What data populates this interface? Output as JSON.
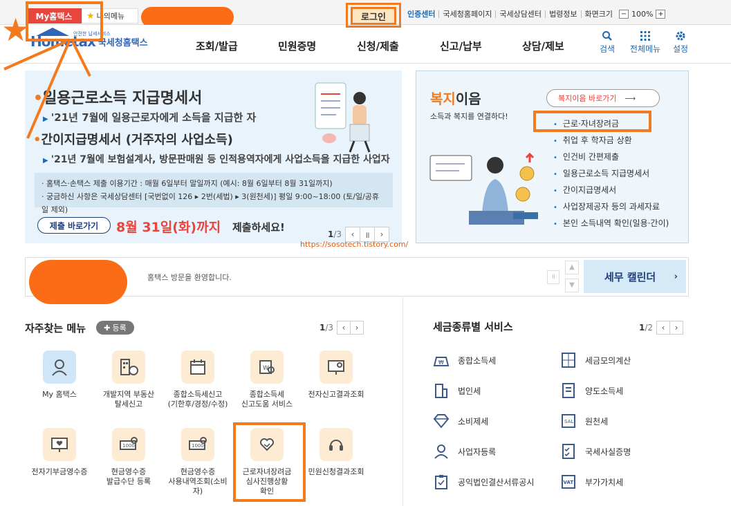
{
  "topbar": {
    "my_tab": "My홈택스",
    "fav_tab": "나의메뉴",
    "login": "로그인",
    "links": [
      "인증센터",
      "국세청홈페이지",
      "국세상담센터",
      "법령정보",
      "화면크기"
    ],
    "zoom_minus": "−",
    "zoom_value": "100%",
    "zoom_plus": "+"
  },
  "header": {
    "logo_en": "Hometax",
    "logo_ko": "국세청홈택스",
    "logo_sub": "안전한 납세서비스",
    "nav": [
      "조회/발급",
      "민원증명",
      "신청/제출",
      "신고/납부",
      "상담/제보"
    ],
    "tools": [
      {
        "label": "검색",
        "icon": "search-icon"
      },
      {
        "label": "전체메뉴",
        "icon": "grid-menu-icon"
      },
      {
        "label": "설정",
        "icon": "gear-icon"
      }
    ]
  },
  "banner": {
    "heading1": "일용근로소득 지급명세서",
    "text1": "'21년 7월에 일용근로자에게 소득을 지급한 자",
    "heading2": "간이지급명세서 (거주자의 사업소득)",
    "text2": "'21년 7월에 보험설계사, 방문판매원 등 인적용역자에게 사업소득을 지급한 사업자",
    "notice_line1": "· 홈택스·손택스 제출 이용기간 : 매월 6일부터 말일까지 (예시: 8월 6일부터 8월 31일까지)",
    "notice_line2": "· 궁금하신 사항은 국세상담센터 [국번없이 126 ▸ 2번(세법) ▸ 3(원천세)] 평일 9:00~18:00 (토/일/공휴일 제외)",
    "go_button": "제출 바로가기",
    "deadline": "8월 31일(화)까지",
    "deadline_suffix": "제출하세요!",
    "page_current": "1",
    "page_total": "/3"
  },
  "watermark_url": "https://sosotech.tistory.com/",
  "welfare": {
    "title_accent": "복지",
    "title_rest": "이음",
    "subtitle": "소득과 복지를 연결하다!",
    "go_button": "복지이음 바로가기",
    "items": [
      "근로·자녀장려금",
      "취업 후 학자금 상환",
      "인건비 간편제출",
      "일용근로소득 지급명세서",
      "간이지급명세서",
      "사업장제공자 등의 과세자료",
      "본인 소득내역 확인(일용·간이)"
    ]
  },
  "notice_bar": {
    "message": "홈택스 방문을 환영합니다.",
    "calendar_button": "세무 캘린더"
  },
  "frequent": {
    "title": "자주찾는 메뉴",
    "register": "등록",
    "page_current": "1",
    "page_total": "/3",
    "items": [
      {
        "label": "My 홈택스",
        "icon": "person-icon"
      },
      {
        "label": "개발지역 부동산\n탈세신고",
        "icon": "building-money-icon"
      },
      {
        "label": "종합소득세신고\n(기한후/경정/수정)",
        "icon": "calendar-icon"
      },
      {
        "label": "종합소득세\n신고도움 서비스",
        "icon": "document-search-icon"
      },
      {
        "label": "전자신고결과조회",
        "icon": "monitor-search-icon"
      },
      {
        "label": "전자기부금영수증",
        "icon": "monitor-heart-icon"
      },
      {
        "label": "현금영수증\n발급수단 등록",
        "icon": "card-search-icon"
      },
      {
        "label": "현금영수증\n사용내역조회(소비\n자)",
        "icon": "card-search-icon"
      },
      {
        "label": "근로자녀장려금\n심사진행상황\n확인",
        "icon": "heart-hand-icon"
      },
      {
        "label": "민원신청결과조회",
        "icon": "headset-icon"
      }
    ]
  },
  "tax_services": {
    "title": "세금종류별 서비스",
    "page_current": "1",
    "page_total": "/2",
    "items": [
      {
        "label": "종합소득세",
        "icon": "money-bag-icon"
      },
      {
        "label": "세금모의계산",
        "icon": "calculator-icon"
      },
      {
        "label": "법인세",
        "icon": "building-icon"
      },
      {
        "label": "양도소득세",
        "icon": "document-icon"
      },
      {
        "label": "소비제세",
        "icon": "diamond-icon"
      },
      {
        "label": "원천세",
        "icon": "receipt-icon"
      },
      {
        "label": "사업자등록",
        "icon": "person-icon"
      },
      {
        "label": "국세사실증명",
        "icon": "checklist-icon"
      },
      {
        "label": "공익법인결산서류공시",
        "icon": "clipboard-icon"
      },
      {
        "label": "부가가치세",
        "icon": "vat-icon"
      }
    ]
  },
  "colors": {
    "accent": "#f47a20",
    "brand": "#2e66b8",
    "red": "#e8453c"
  }
}
